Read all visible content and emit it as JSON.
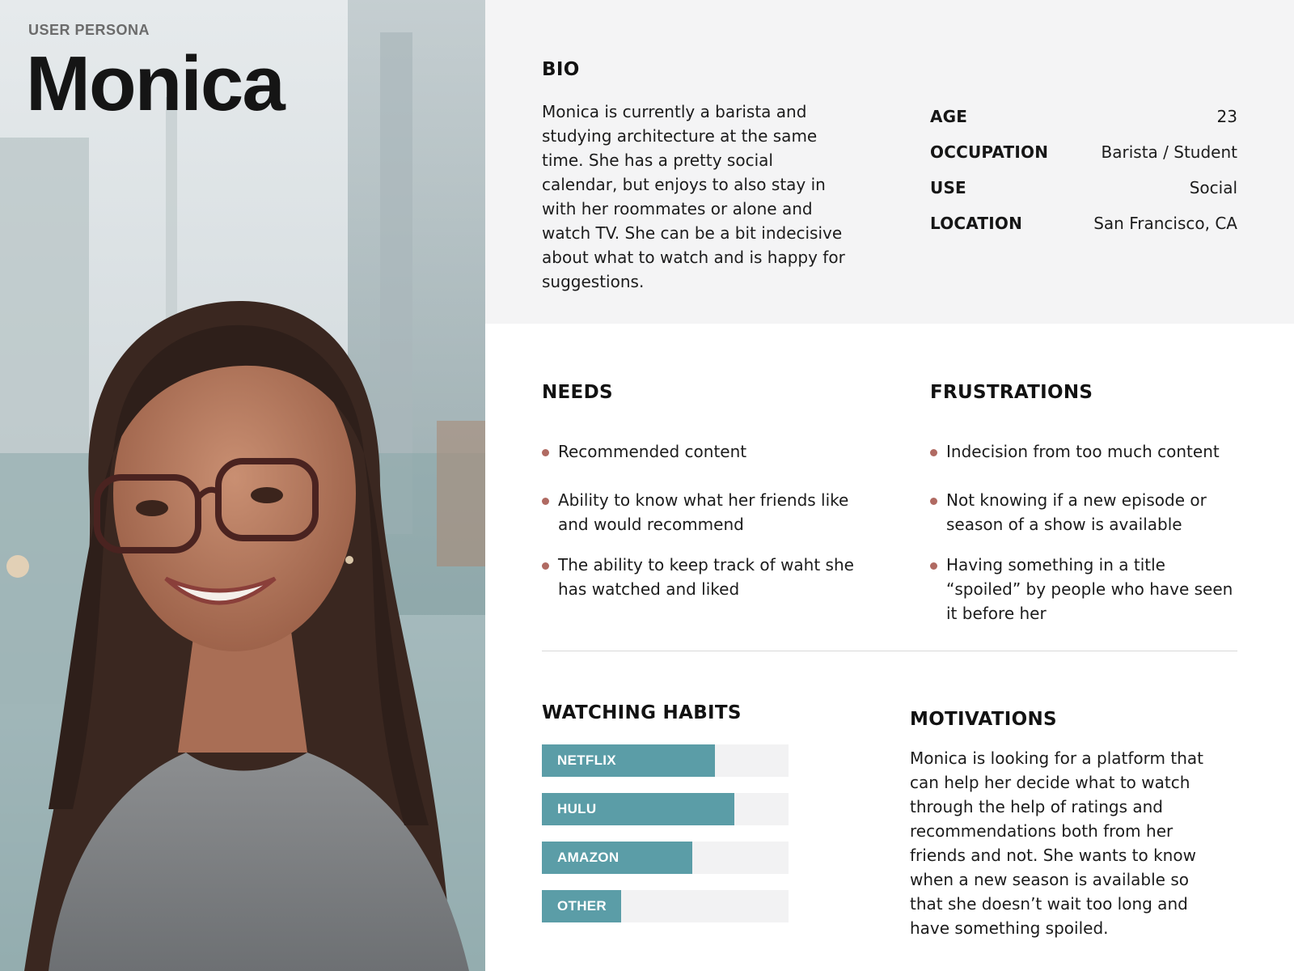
{
  "header": {
    "eyebrow": "USER PERSONA",
    "name": "Monica"
  },
  "photo": {
    "icon": "portrait-photo"
  },
  "bio": {
    "title": "BIO",
    "text": "Monica is currently a barista and studying architecture at the same time. She has a pretty social calendar, but enjoys to also stay in with her roommates or alone and watch TV. She can be a bit indecisive about what to watch and is happy for suggestions.",
    "facts": [
      {
        "label": "AGE",
        "value": "23"
      },
      {
        "label": "OCCUPATION",
        "value": "Barista / Student"
      },
      {
        "label": "USE",
        "value": "Social"
      },
      {
        "label": "LOCATION",
        "value": "San Francisco, CA"
      }
    ]
  },
  "needs": {
    "title": "NEEDS",
    "items": [
      "Recommended content",
      "Ability to know what her friends like and would recommend",
      "The ability to keep track of waht she has watched and liked"
    ]
  },
  "frustrations": {
    "title": "FRUSTRATIONS",
    "items": [
      "Indecision from too much content",
      "Not knowing if a new episode or season of a show is available",
      "Having something in a title “spoiled” by people who have seen it before her"
    ]
  },
  "watching_habits": {
    "title": "WATCHING HABITS",
    "bars": [
      {
        "label": "NETFLIX",
        "fraction": 0.7
      },
      {
        "label": "HULU",
        "fraction": 0.78
      },
      {
        "label": "AMAZON",
        "fraction": 0.61
      },
      {
        "label": "OTHER",
        "fraction": 0.32
      }
    ]
  },
  "motivations": {
    "title": "MOTIVATIONS",
    "text": "Monica is looking for a platform that can help her decide what to watch through the help of ratings and recommendations both from her friends and not. She wants to know when a new season is available so that she doesn’t wait too long and have something spoiled."
  },
  "colors": {
    "accent_bar": "#5b9da7",
    "bullet": "#b06a62",
    "panel_bg": "#f4f4f5"
  }
}
